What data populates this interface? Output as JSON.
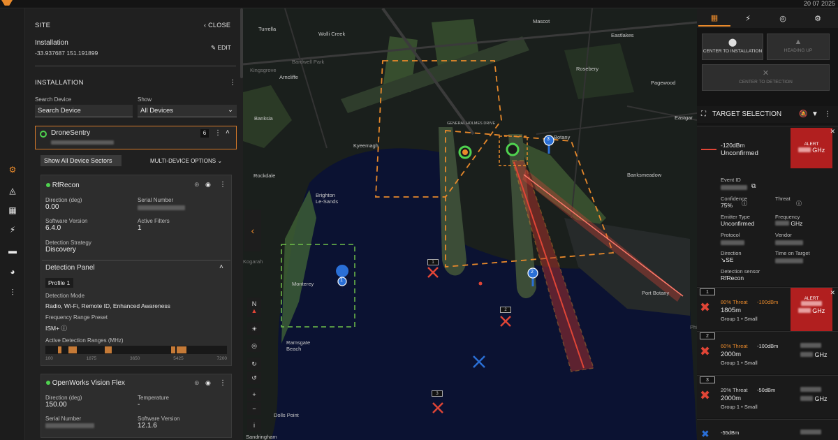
{
  "topbar": {
    "timestamp": "20 07 2025"
  },
  "rail": {
    "icons": [
      "gear-icon",
      "radar-sweep-icon",
      "map-icon",
      "bolt-icon",
      "folder-icon",
      "pie-chart-icon",
      "sliders-icon"
    ]
  },
  "site": {
    "title": "SITE",
    "close_label": "CLOSE",
    "installation_name": "Installation",
    "coords": "-33.937687  151.191899",
    "edit_label": "EDIT",
    "section_label": "INSTALLATION",
    "search_label": "Search Device",
    "search_placeholder": "Search Device",
    "show_label": "Show",
    "show_value": "All Devices",
    "device_name": "DroneSentry",
    "device_count": "6",
    "show_sectors_label": "Show All Device Sectors",
    "multi_device_label": "MULTI-DEVICE OPTIONS",
    "rfrecon": {
      "name": "RfRecon",
      "direction_label": "Direction (deg)",
      "direction_value": "0.00",
      "serial_label": "Serial Number",
      "sw_label": "Software Version",
      "sw_value": "6.4.0",
      "filters_label": "Active Filters",
      "filters_value": "1",
      "strategy_label": "Detection Strategy",
      "strategy_value": "Discovery",
      "panel_title": "Detection Panel",
      "profile": "Profile 1",
      "mode_label": "Detection Mode",
      "mode_value": "Radio, Wi-Fi, Remote ID, Enhanced Awareness",
      "preset_label": "Frequency Range Preset",
      "preset_value": "ISM+",
      "ranges_label": "Active Detection Ranges (MHz)",
      "ticks": [
        "100",
        "1875",
        "3650",
        "5425",
        "7200"
      ]
    },
    "openworks": {
      "name": "OpenWorks Vision Flex",
      "direction_label": "Direction (deg)",
      "direction_value": "150.00",
      "temp_label": "Temperature",
      "temp_value": "-",
      "serial_label": "Serial Number",
      "sw_label": "Software Version",
      "sw_value": "12.1.6"
    }
  },
  "map": {
    "labels": [
      "Turrella",
      "Wolli Creek",
      "Mascot",
      "Eastlakes",
      "Arncliffe",
      "Rosebery",
      "Pagewood",
      "Banksia",
      "Eastgar",
      "Kyeemagh",
      "Botany",
      "Rockdale",
      "Banksmeadow",
      "Brighton\nLe-Sands",
      "Monterey",
      "Port Botany",
      "Ramsgate\nBeach",
      "Dolls Point",
      "Sandringham",
      "Kingsgrove",
      "Bardwell Park",
      "GENERAL HOLMES DRIVE",
      "Kogarah",
      "Philip Bay"
    ],
    "markers": [
      "1",
      "2",
      "3"
    ],
    "drone_tags": [
      "1",
      "2",
      "3"
    ],
    "tools": [
      "N",
      "☀",
      "◎",
      "↻",
      "↺",
      "+",
      "−",
      "i"
    ]
  },
  "right": {
    "center_install_label": "CENTER TO INSTALLATION",
    "heading_label": "HEADING UP",
    "center_detect_label": "CENTER TO DETECTION",
    "target_title": "TARGET SELECTION",
    "main_target": {
      "signal": "-120dBm",
      "status": "Unconfirmed",
      "alert": "ALERT",
      "freq_unit": "GHz",
      "event_label": "Event ID",
      "confidence_label": "Confidence",
      "confidence_value": "75%",
      "threat_label": "Threat",
      "emitter_label": "Emitter Type",
      "emitter_value": "Unconfirmed",
      "frequency_label": "Frequency",
      "frequency_unit": "GHz",
      "protocol_label": "Protocol",
      "vendor_label": "Vendor",
      "direction_label": "Direction",
      "direction_value": "↘SE",
      "tot_label": "Time on Target",
      "sensor_label": "Detection sensor",
      "sensor_value": "RfRecon"
    },
    "targets": [
      {
        "tag": "1",
        "threat": "80% Threat",
        "dbm": "-100dBm",
        "range": "1805m",
        "group": "Group 1  •  Small",
        "alert": "ALERT",
        "unit": "GHz"
      },
      {
        "tag": "2",
        "threat": "60% Threat",
        "dbm": "-100dBm",
        "range": "2000m",
        "group": "Group 1  •  Small",
        "unit": "GHz"
      },
      {
        "tag": "3",
        "threat": "20% Threat",
        "dbm": "-50dBm",
        "range": "2000m",
        "group": "Group 1  •  Small",
        "unit": "GHz"
      },
      {
        "tag": "",
        "threat": "",
        "dbm": "-55dBm",
        "range": "",
        "group": "",
        "unit": "GHz"
      }
    ]
  },
  "colors": {
    "accent": "#e8892b",
    "alert": "#b11f1f",
    "ok": "#4fd24f",
    "marker_blue": "#2a6fd6",
    "threat_red": "#e04536"
  }
}
